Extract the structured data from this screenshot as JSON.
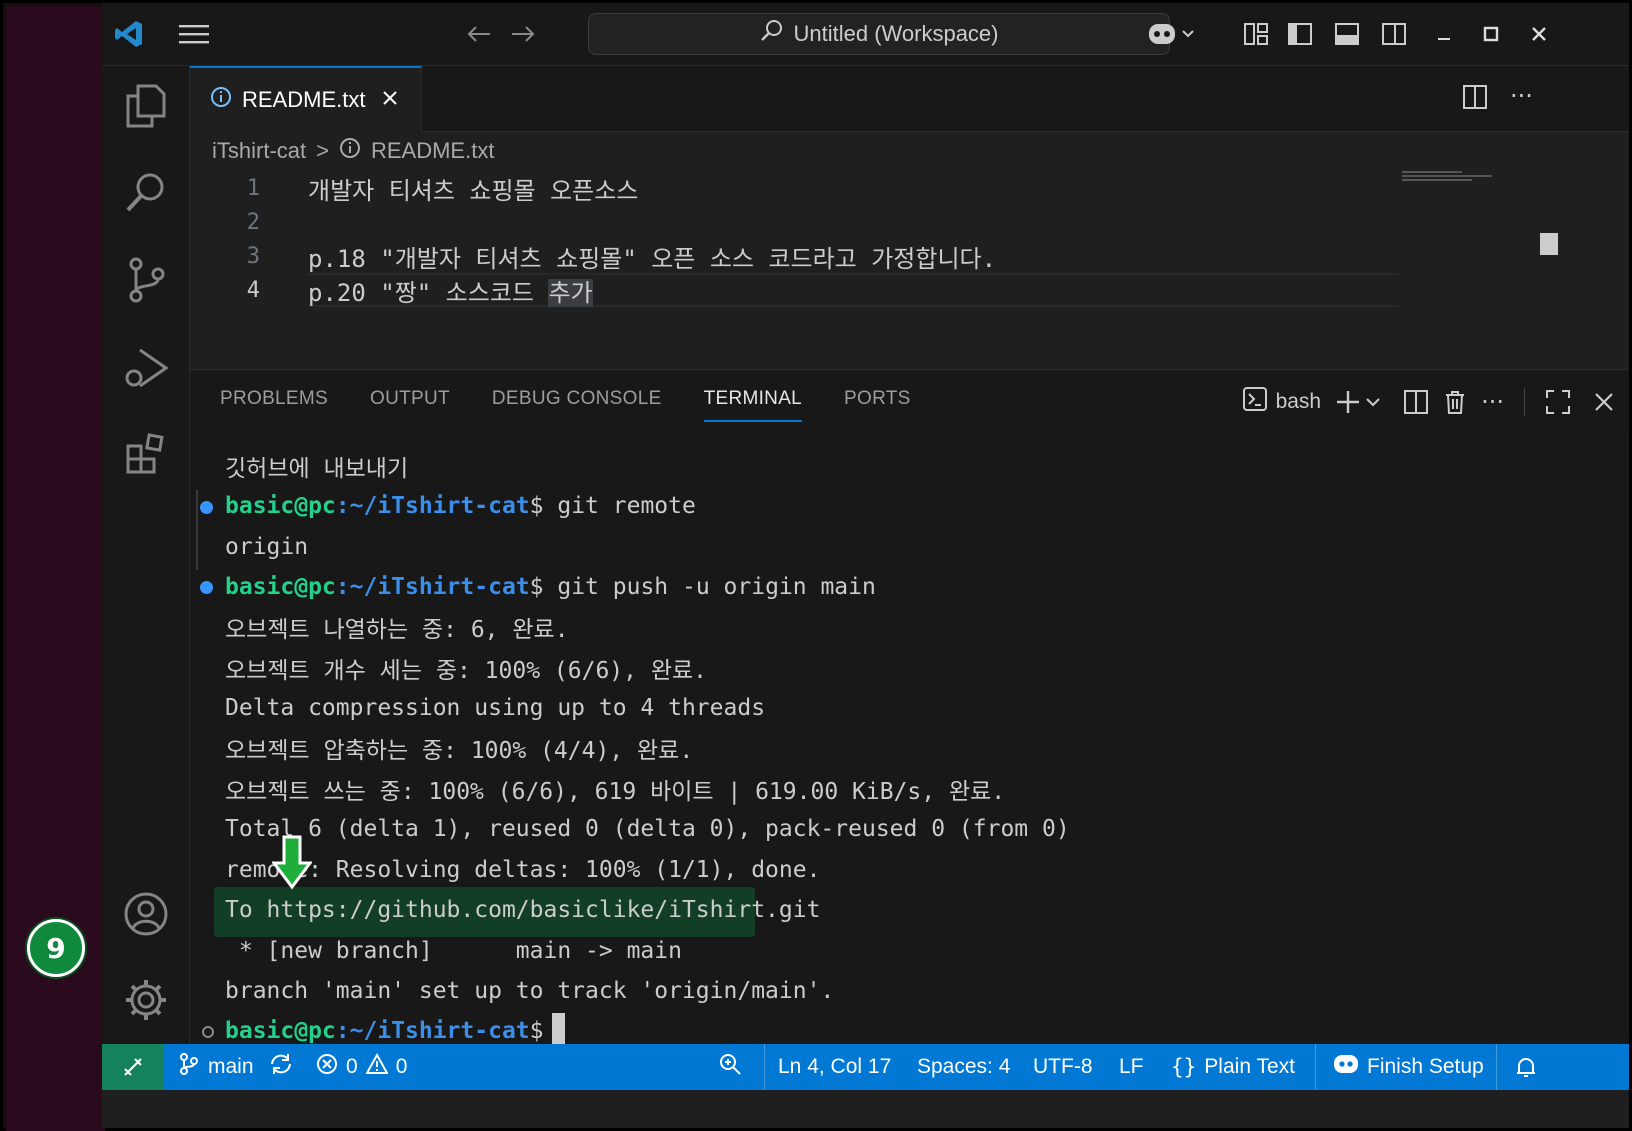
{
  "titlebar": {
    "search_text": "Untitled (Workspace)"
  },
  "tabs": [
    {
      "label": "README.txt"
    }
  ],
  "breadcrumb": {
    "folder": "iTshirt-cat",
    "separator": ">",
    "file": "README.txt"
  },
  "editor": {
    "lines": [
      {
        "number": "1",
        "text": "개발자 티셔츠 쇼핑몰 오픈소스"
      },
      {
        "number": "2",
        "text": ""
      },
      {
        "number": "3",
        "text": "p.18 \"개발자 티셔츠 쇼핑몰\" 오픈 소스 코드라고 가정합니다."
      },
      {
        "number": "4",
        "text": "p.20 \"짱\" 소스코드 ",
        "selected": "추가"
      }
    ]
  },
  "panel": {
    "tabs": [
      "PROBLEMS",
      "OUTPUT",
      "DEBUG CONSOLE",
      "TERMINAL",
      "PORTS"
    ],
    "active_tab": "TERMINAL",
    "shell": "bash"
  },
  "terminal": {
    "prompt_user": "basic@pc",
    "prompt_path": ":~/iTshirt-cat",
    "prompt_symbol": "$",
    "lines": [
      "깃허브에 내보내기",
      " git remote",
      "origin",
      " git push -u origin main",
      "오브젝트 나열하는 중: 6, 완료.",
      "오브젝트 개수 세는 중: 100% (6/6), 완료.",
      "Delta compression using up to 4 threads",
      "오브젝트 압축하는 중: 100% (4/4), 완료.",
      "오브젝트 쓰는 중: 100% (6/6), 619 바이트 | 619.00 KiB/s, 완료.",
      "Total 6 (delta 1), reused 0 (delta 0), pack-reused 0 (from 0)",
      "remote: Resolving deltas: 100% (1/1), done.",
      "To https://github.com/basiclike/iTshirt.git",
      " * [new branch]      main -> main",
      "branch 'main' set up to track 'origin/main'."
    ]
  },
  "statusbar": {
    "branch": "main",
    "errors": "0",
    "warnings": "0",
    "position": "Ln 4, Col 17",
    "spaces": "Spaces: 4",
    "encoding": "UTF-8",
    "eol": "LF",
    "language": "Plain Text",
    "setup": "Finish Setup"
  },
  "callout": {
    "step": "9"
  },
  "colors": {
    "accent": "#0078d4",
    "prompt_green": "#23d18b",
    "prompt_blue": "#3b8eea",
    "remote_green": "#16825d",
    "badge_green": "#0f8a3c"
  }
}
